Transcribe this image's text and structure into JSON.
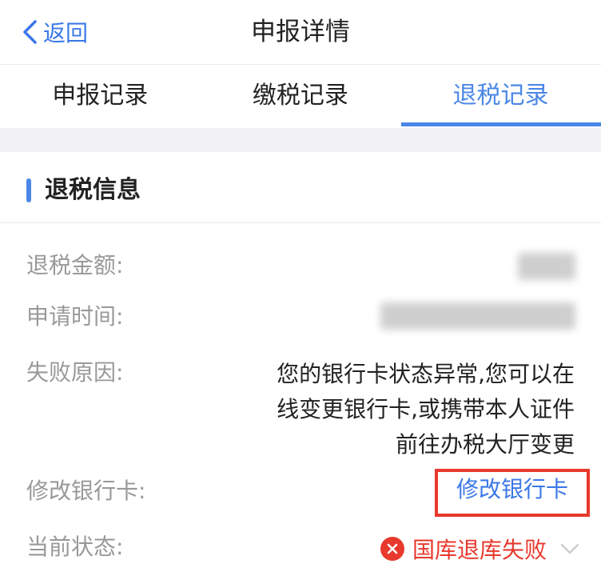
{
  "nav": {
    "back_label": "返回",
    "title": "申报详情"
  },
  "tabs": [
    {
      "label": "申报记录"
    },
    {
      "label": "缴税记录"
    },
    {
      "label": "退税记录"
    }
  ],
  "section": {
    "title": "退税信息"
  },
  "rows": {
    "refund_amount_label": "退税金额:",
    "apply_time_label": "申请时间:",
    "fail_reason_label": "失败原因:",
    "fail_reason_value": "您的银行卡状态异常,您可以在线变更银行卡,或携带本人证件前往办税大厅变更",
    "modify_card_label": "修改银行卡:",
    "modify_card_link": "修改银行卡",
    "status_label": "当前状态:",
    "status_value": "国库退库失败"
  },
  "colors": {
    "accent": "#4b87e6",
    "error": "#e8392d",
    "muted": "#999999"
  },
  "icons": {
    "back": "chevron-left-icon",
    "status": "close-circle-icon",
    "expand": "chevron-down-icon"
  }
}
